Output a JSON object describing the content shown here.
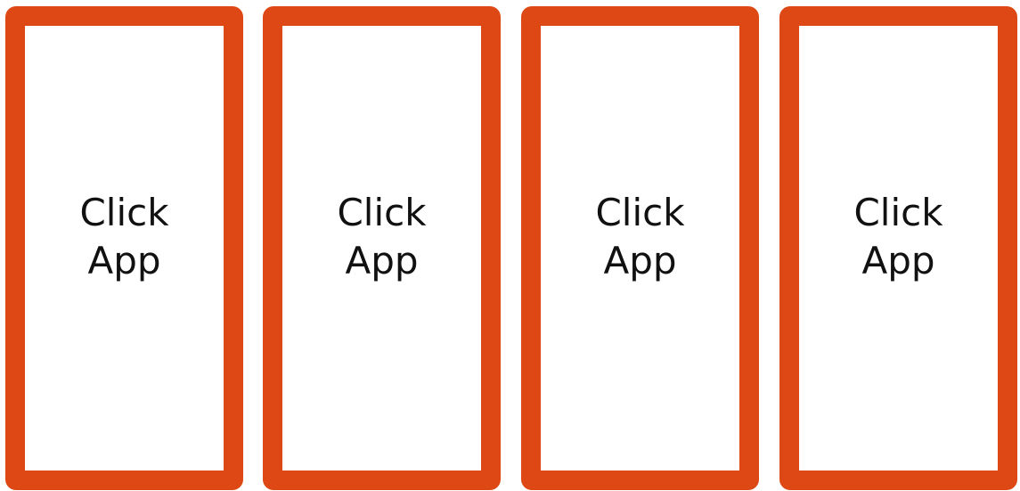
{
  "colors": {
    "tile_border": "#dd4814",
    "tile_background": "#ffffff",
    "label_text": "#111111"
  },
  "tiles": [
    {
      "label": "Click App"
    },
    {
      "label": "Click App"
    },
    {
      "label": "Click App"
    },
    {
      "label": "Click App"
    }
  ]
}
